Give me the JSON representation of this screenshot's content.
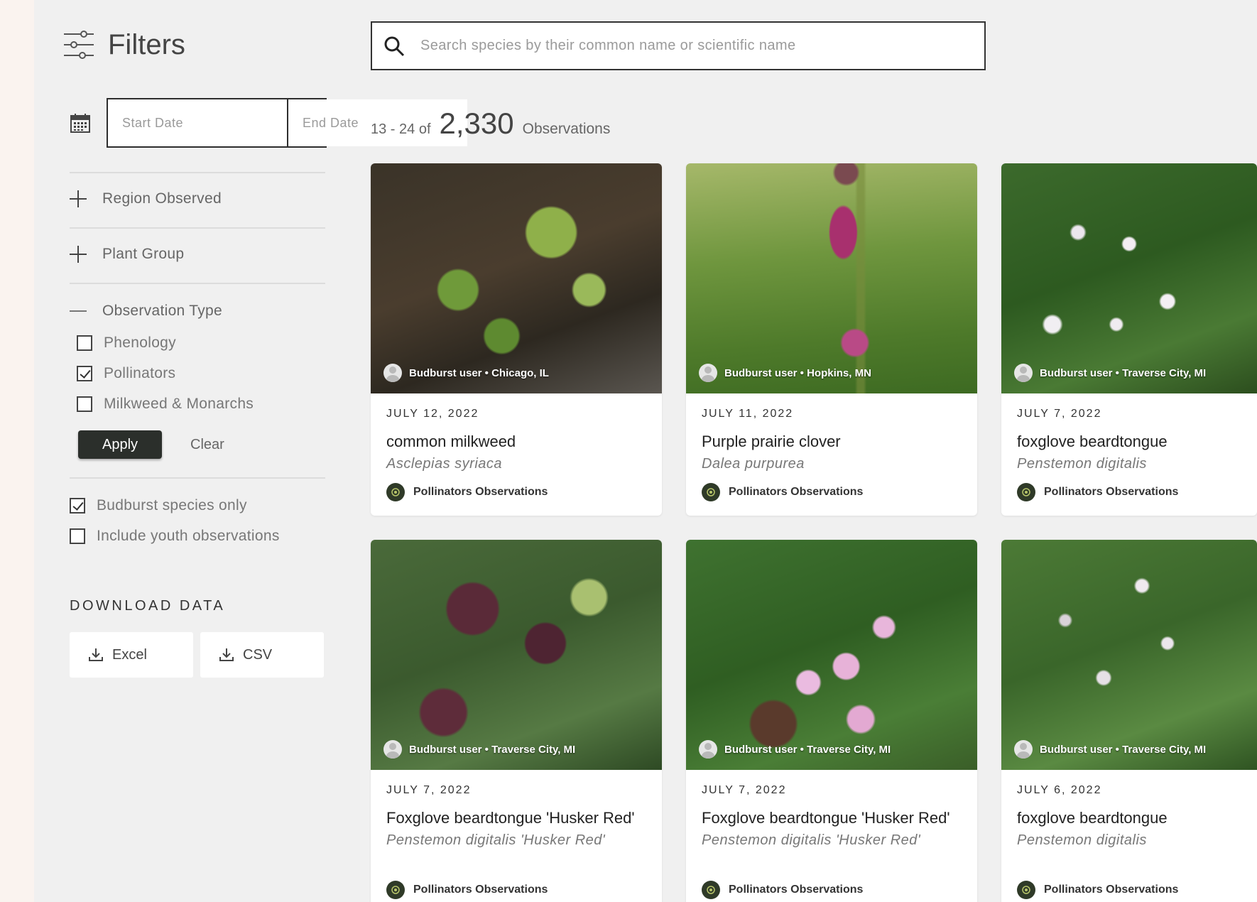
{
  "sidebar": {
    "title": "Filters",
    "start_date_placeholder": "Start Date",
    "end_date_placeholder": "End Date",
    "sections": {
      "region": "Region Observed",
      "plant_group": "Plant Group",
      "observation_type": "Observation Type"
    },
    "observation_types": [
      {
        "label": "Phenology",
        "checked": false
      },
      {
        "label": "Pollinators",
        "checked": true
      },
      {
        "label": "Milkweed & Monarchs",
        "checked": false
      }
    ],
    "apply_label": "Apply",
    "clear_label": "Clear",
    "budburst_only": {
      "label": "Budburst species only",
      "checked": true
    },
    "include_youth": {
      "label": "Include youth observations",
      "checked": false
    },
    "download_title": "DOWNLOAD DATA",
    "download_excel": "Excel",
    "download_csv": "CSV"
  },
  "search": {
    "placeholder": "Search species by their common name or scientific name"
  },
  "results": {
    "range": "13 - 24 of",
    "total": "2,330",
    "unit": "Observations"
  },
  "cards": [
    {
      "user": "Budburst user • Chicago, IL",
      "date": "JULY 12, 2022",
      "name": "common milkweed",
      "sci": "Asclepias syriaca",
      "program": "Pollinators Observations"
    },
    {
      "user": "Budburst user • Hopkins, MN",
      "date": "JULY 11, 2022",
      "name": "Purple prairie clover",
      "sci": "Dalea purpurea",
      "program": "Pollinators Observations"
    },
    {
      "user": "Budburst user • Traverse City, MI",
      "date": "JULY 7, 2022",
      "name": "foxglove beardtongue",
      "sci": "Penstemon digitalis",
      "program": "Pollinators Observations"
    },
    {
      "user": "Budburst user • Traverse City, MI",
      "date": "JULY 7, 2022",
      "name": "Foxglove beardtongue 'Husker Red'",
      "sci": "Penstemon digitalis 'Husker Red'",
      "program": "Pollinators Observations"
    },
    {
      "user": "Budburst user • Traverse City, MI",
      "date": "JULY 7, 2022",
      "name": "Foxglove beardtongue 'Husker Red'",
      "sci": "Penstemon digitalis 'Husker Red'",
      "program": "Pollinators Observations"
    },
    {
      "user": "Budburst user • Traverse City, MI",
      "date": "JULY 6, 2022",
      "name": "foxglove beardtongue",
      "sci": "Penstemon digitalis",
      "program": "Pollinators Observations"
    }
  ],
  "colors": {
    "background": "#f0f0f0",
    "apply_button": "#2b2f2b",
    "program_icon": "#2f3a28"
  }
}
